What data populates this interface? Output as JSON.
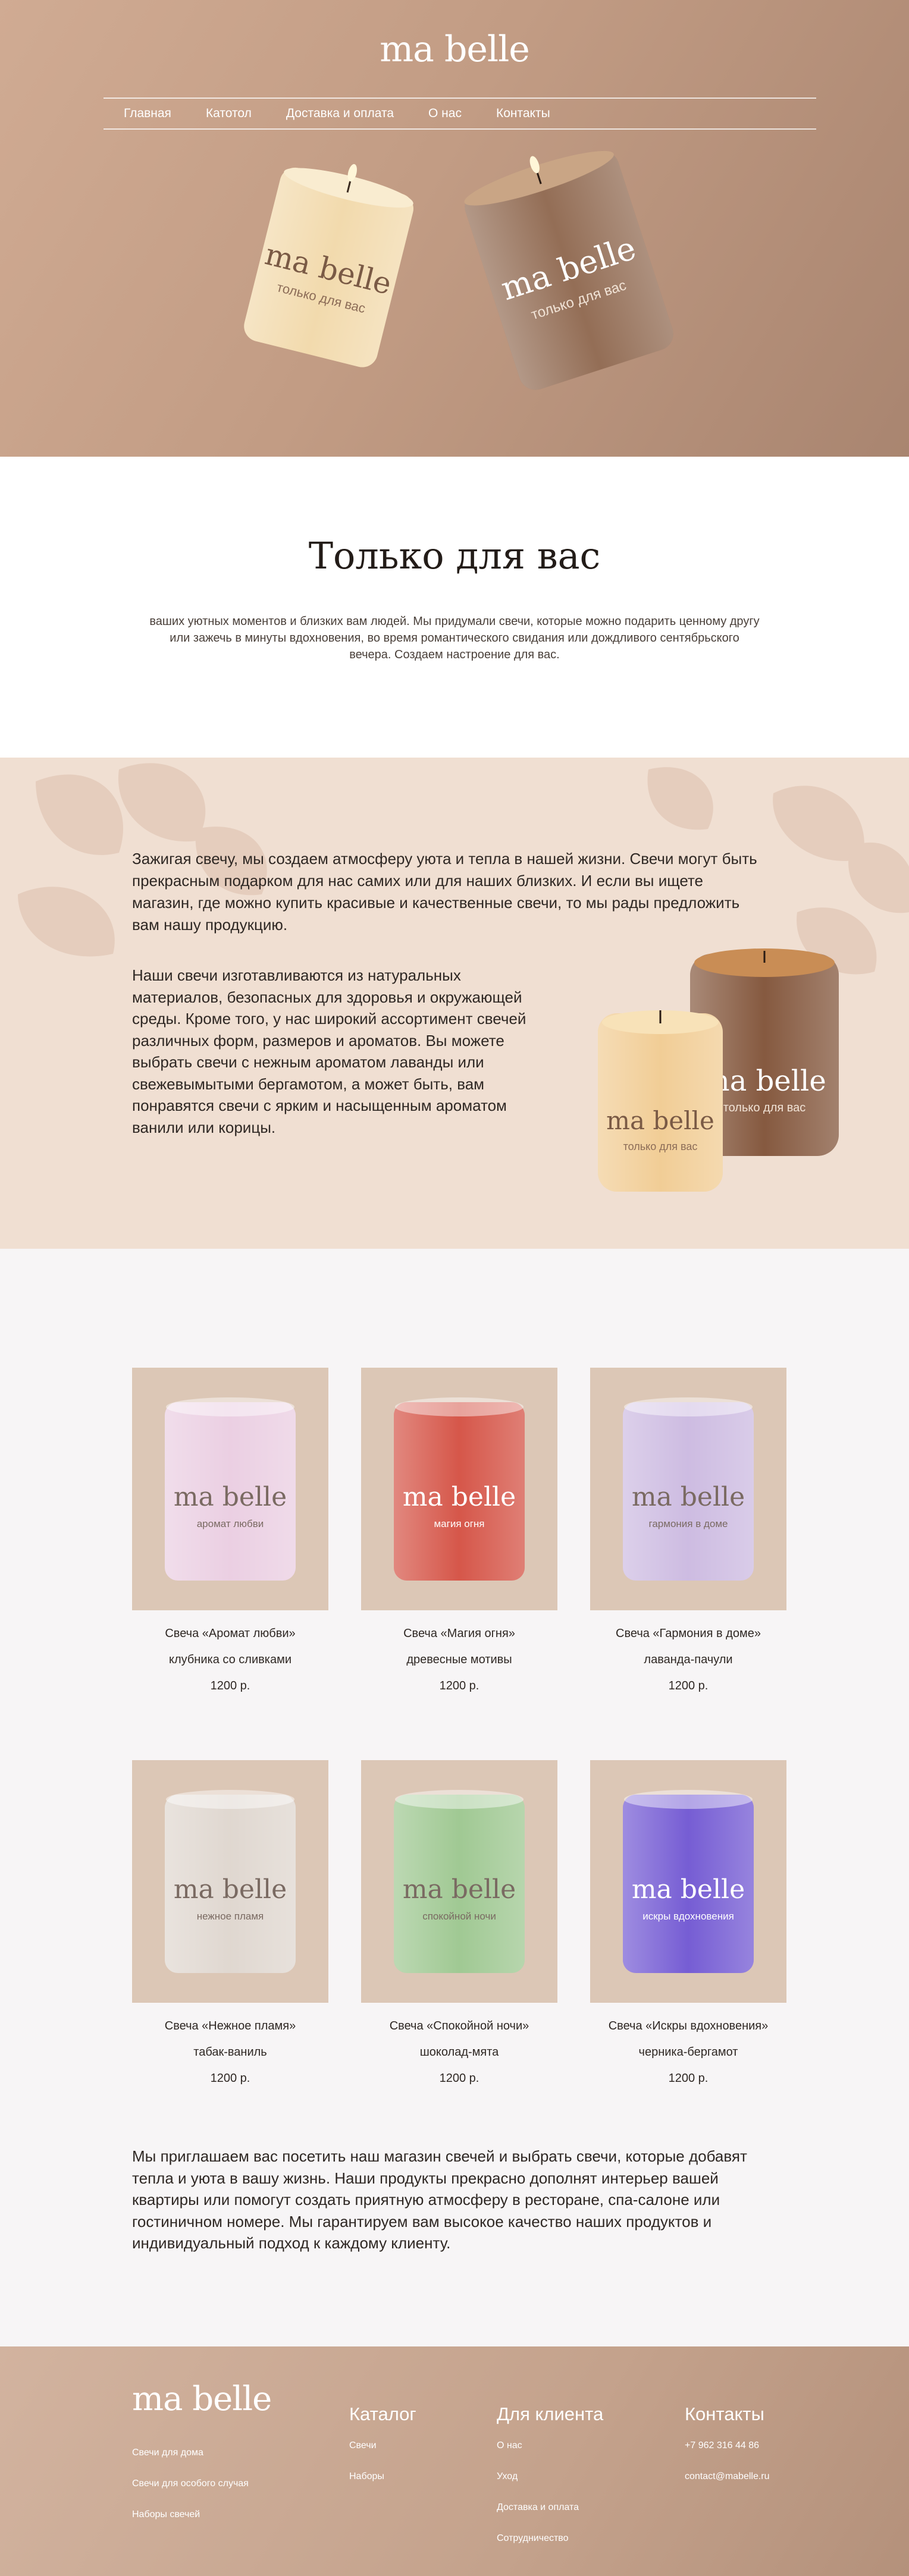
{
  "brand": {
    "logo": "ma belle"
  },
  "nav": {
    "items": [
      "Главная",
      "Катотол",
      "Доставка и оплата",
      "О нас",
      "Контакты"
    ]
  },
  "hero": {
    "candles": [
      {
        "brand": "ma belle",
        "label": "только для вас",
        "color": "#f1d7a6"
      },
      {
        "brand": "ma belle",
        "label": "только для вас",
        "color": "#8a6147"
      }
    ]
  },
  "intro": {
    "title": "Только для вас",
    "text": "ваших уютных моментов и близких вам людей. Мы придумали свечи, которые можно подарить ценному другу или зажечь в минуты вдохновения, во время романтического свидания или дождливого сентябрьского вечера. Создаем настроение для вас."
  },
  "about": {
    "paragraph1": "Зажигая свечу, мы создаем атмосферу уюта и тепла в нашей жизни. Свечи могут быть прекрасным подарком для нас самих или для наших близких. И если вы ищете магазин, где можно купить красивые и качественные свечи, то мы рады предложить вам нашу продукцию.",
    "paragraph2": "Наши свечи изготавливаются из натуральных материалов, безопасных для здоровья и окружающей среды. Кроме того, у нас широкий ассортимент свечей различных форм, размеров и ароматов. Вы можете выбрать свечи с нежным ароматом лаванды или свежевымытыми бергамотом, а может быть, вам понравятся свечи с ярким и насыщенным ароматом ванили или корицы.",
    "candles": [
      {
        "brand": "ma belle",
        "label": "только для вас",
        "color": "#f0c98d"
      },
      {
        "brand": "ma belle",
        "label": "только для вас",
        "color": "#7b4b2f"
      }
    ]
  },
  "products": [
    {
      "name": "Свеча «Аромат любви»",
      "notes": "клубника со сливками",
      "price": "1200 р.",
      "label": "аромат любви",
      "color": "#e9cbe0"
    },
    {
      "name": "Свеча «Магия огня»",
      "notes": "древесные мотивы",
      "price": "1200 р.",
      "label": "магия огня",
      "color": "#d2483a"
    },
    {
      "name": "Свеча «Гармония в доме»",
      "notes": "лаванда-пачули",
      "price": "1200 р.",
      "label": "гармония в доме",
      "color": "#c9b6df"
    },
    {
      "name": "Свеча «Нежное пламя»",
      "notes": "табак-ваниль",
      "price": "1200 р.",
      "label": "нежное пламя",
      "color": "#ddd4cc"
    },
    {
      "name": "Свеча «Спокойной ночи»",
      "notes": "шоколад-мята",
      "price": "1200 р.",
      "label": "спокойной ночи",
      "color": "#98c48a"
    },
    {
      "name": "Свеча «Искры вдохновения»",
      "notes": "черника-бергамот",
      "price": "1200 р.",
      "label": "искры вдохновения",
      "color": "#6a4fd0"
    }
  ],
  "outro": {
    "text": "Мы приглашаем вас посетить наш магазин свечей и выбрать свечи, которые добавят тепла и уюта в вашу жизнь. Наши продукты прекрасно дополнят интерьер вашей квартиры или помогут создать приятную атмосферу в ресторане, спа-салоне или гостиничном номере. Мы гарантируем вам высокое качество наших продуктов и индивидуальный подход к каждому клиенту."
  },
  "footer": {
    "logo": "ma belle",
    "brand_links": [
      "Свечи для дома",
      "Свечи для особого случая",
      "Наборы свечей"
    ],
    "columns": [
      {
        "title": "Каталог",
        "links": [
          "Свечи",
          "Наборы"
        ]
      },
      {
        "title": "Для клиента",
        "links": [
          "О нас",
          "Уход",
          "Доставка и оплата",
          "Сотрудничество"
        ]
      },
      {
        "title": "Контакты",
        "links": [
          "+7 962 316 44 86",
          "contact@mabelle.ru"
        ]
      }
    ]
  }
}
